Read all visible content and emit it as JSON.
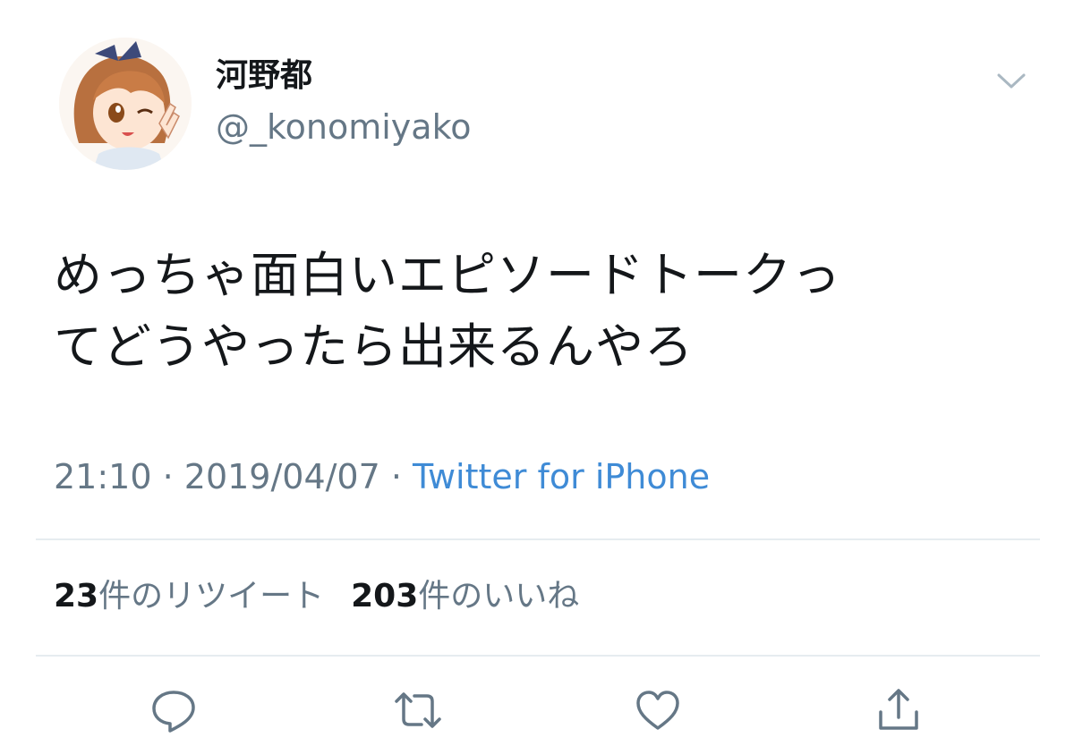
{
  "user": {
    "display_name": "河野都",
    "handle": "@_konomiyako"
  },
  "tweet": {
    "text_lines": [
      "めっちゃ面白いエピソードトークっ",
      "てどうやったら出来るんやろ"
    ],
    "time": "21:10",
    "separator": " · ",
    "date": "2019/04/07",
    "source": "Twitter for iPhone"
  },
  "stats": {
    "retweet_count": "23",
    "retweet_label": "件のリツイート",
    "like_count": "203",
    "like_label": "件のいいね"
  },
  "actions": {
    "reply_icon": "reply-icon",
    "retweet_icon": "retweet-icon",
    "like_icon": "heart-icon",
    "share_icon": "share-icon"
  },
  "colors": {
    "text": "#14171a",
    "secondary": "#657786",
    "link": "#3f8bd6",
    "divider": "#e6ecf0"
  }
}
